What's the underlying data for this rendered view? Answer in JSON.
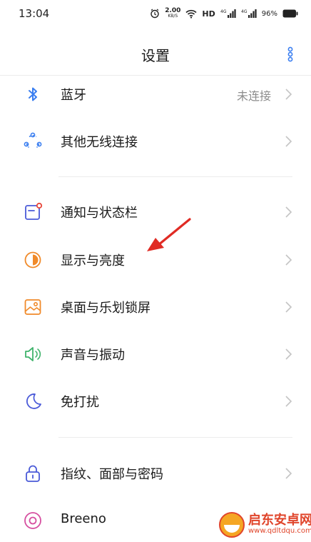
{
  "status_bar": {
    "time": "13:04",
    "net_speed": "2.00",
    "net_unit": "KB/S",
    "hd": "HD",
    "signal1": "4G",
    "signal2": "4G",
    "battery": "96%"
  },
  "header": {
    "title": "设置"
  },
  "settings": [
    {
      "label": "蓝牙",
      "value": "未连接",
      "icon": "bluetooth-icon"
    },
    {
      "label": "其他无线连接",
      "icon": "wireless-connection-icon"
    },
    {
      "label": "通知与状态栏",
      "icon": "notification-icon"
    },
    {
      "label": "显示与亮度",
      "icon": "brightness-icon"
    },
    {
      "label": "桌面与乐划锁屏",
      "icon": "wallpaper-icon"
    },
    {
      "label": "声音与振动",
      "icon": "sound-icon"
    },
    {
      "label": "免打扰",
      "icon": "moon-icon"
    },
    {
      "label": "指纹、面部与密码",
      "icon": "lock-icon"
    },
    {
      "label": "Breeno",
      "icon": "breeno-icon"
    }
  ],
  "colors": {
    "blue": "#3a7ef0",
    "red": "#e8473a",
    "orange": "#f08a2a",
    "green": "#3fb36b",
    "purple": "#4a5ad8",
    "pink": "#d64fa0"
  },
  "watermark": {
    "title": "启东安卓网",
    "url": "www.qdltdqu.com"
  }
}
